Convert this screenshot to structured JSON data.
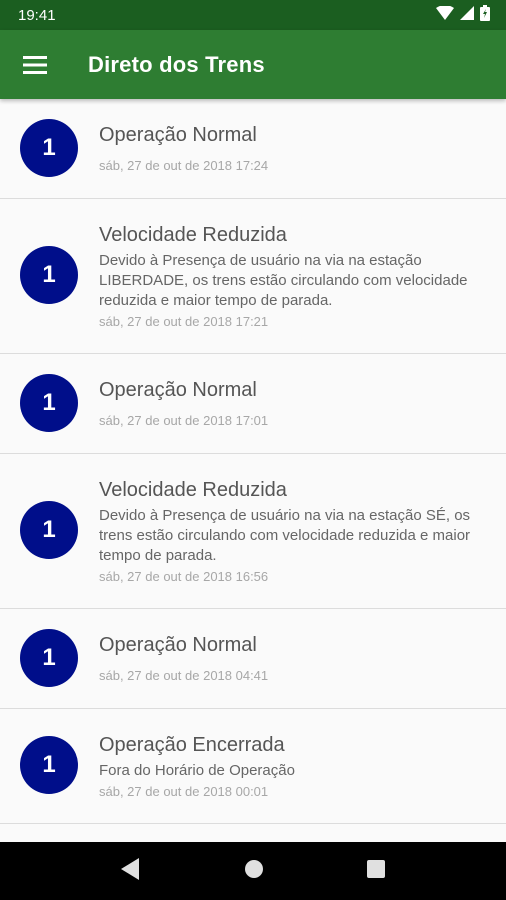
{
  "status_bar": {
    "time": "19:41",
    "icons": [
      "wifi-icon",
      "signal-icon",
      "battery-icon"
    ]
  },
  "app_bar": {
    "title": "Direto dos Trens",
    "menu_icon": "hamburger-menu-icon",
    "color": "#2e7d32"
  },
  "items": [
    {
      "badge": "1",
      "title": "Operação Normal",
      "description": "",
      "date": "sáb, 27 de out de 2018 17:24"
    },
    {
      "badge": "1",
      "title": "Velocidade Reduzida",
      "description": "Devido à Presença de usuário na via  na estação LIBERDADE, os trens estão circulando com velocidade reduzida e maior tempo de parada.",
      "date": "sáb, 27 de out de 2018 17:21"
    },
    {
      "badge": "1",
      "title": "Operação Normal",
      "description": "",
      "date": "sáb, 27 de out de 2018 17:01"
    },
    {
      "badge": "1",
      "title": "Velocidade Reduzida",
      "description": "Devido à Presença de usuário na via  na estação SÉ, os trens estão circulando com velocidade reduzida e maior tempo de parada.",
      "date": "sáb, 27 de out de 2018 16:56"
    },
    {
      "badge": "1",
      "title": "Operação Normal",
      "description": "",
      "date": "sáb, 27 de out de 2018 04:41"
    },
    {
      "badge": "1",
      "title": "Operação Encerrada",
      "description": "Fora do Horário de Operação",
      "date": "sáb, 27 de out de 2018 00:01"
    }
  ],
  "nav_bar": {
    "buttons": [
      "back-icon",
      "home-icon",
      "recents-icon"
    ]
  },
  "colors": {
    "badge": "#000e8a",
    "status_bar": "#1b5e20"
  }
}
